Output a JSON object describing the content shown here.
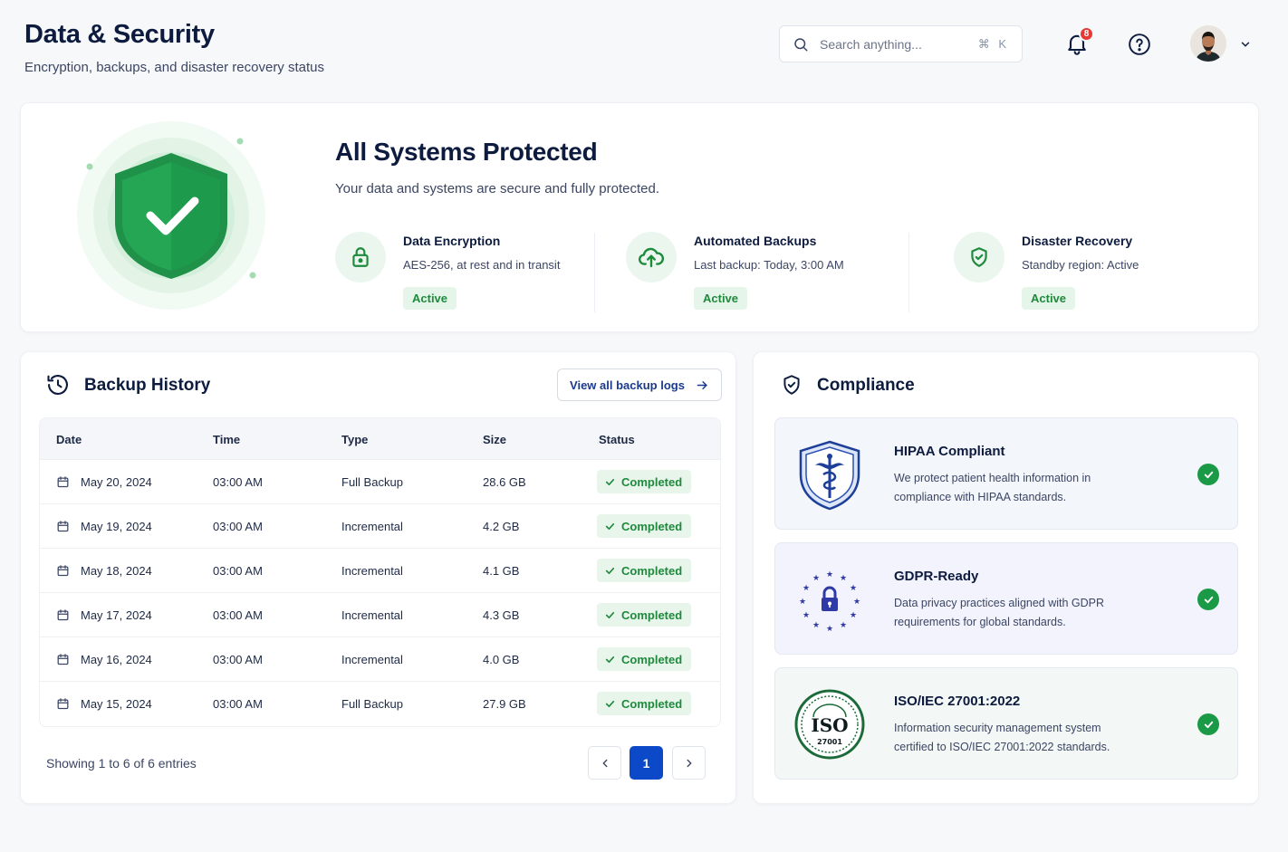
{
  "header": {
    "title": "Data & Security",
    "subtitle": "Encryption, backups, and disaster recovery status",
    "search_placeholder": "Search anything...",
    "search_shortcut": "⌘ K",
    "notification_count": "8"
  },
  "hero": {
    "title": "All Systems Protected",
    "subtitle": "Your data and systems are secure and fully protected.",
    "features": [
      {
        "title": "Data Encryption",
        "desc": "AES-256, at rest and in transit",
        "status": "Active",
        "icon": "lock-icon"
      },
      {
        "title": "Automated Backups",
        "desc": "Last backup: Today, 3:00 AM",
        "status": "Active",
        "icon": "cloud-upload-icon"
      },
      {
        "title": "Disaster Recovery",
        "desc": "Standby region: Active",
        "status": "Active",
        "icon": "shield-check-icon"
      }
    ]
  },
  "backup": {
    "title": "Backup History",
    "view_logs": "View all backup logs",
    "columns": [
      "Date",
      "Time",
      "Type",
      "Size",
      "Status"
    ],
    "rows": [
      {
        "date": "May 20, 2024",
        "time": "03:00 AM",
        "type": "Full Backup",
        "size": "28.6 GB",
        "status": "Completed"
      },
      {
        "date": "May 19, 2024",
        "time": "03:00 AM",
        "type": "Incremental",
        "size": "4.2 GB",
        "status": "Completed"
      },
      {
        "date": "May 18, 2024",
        "time": "03:00 AM",
        "type": "Incremental",
        "size": "4.1 GB",
        "status": "Completed"
      },
      {
        "date": "May 17, 2024",
        "time": "03:00 AM",
        "type": "Incremental",
        "size": "4.3 GB",
        "status": "Completed"
      },
      {
        "date": "May 16, 2024",
        "time": "03:00 AM",
        "type": "Incremental",
        "size": "4.0 GB",
        "status": "Completed"
      },
      {
        "date": "May 15, 2024",
        "time": "03:00 AM",
        "type": "Full Backup",
        "size": "27.9 GB",
        "status": "Completed"
      }
    ],
    "showing": "Showing 1 to 6 of 6 entries",
    "current_page": "1"
  },
  "compliance": {
    "title": "Compliance",
    "items": [
      {
        "title": "HIPAA Compliant",
        "desc": "We protect patient health information in compliance with HIPAA standards.",
        "icon": "hipaa-shield-icon"
      },
      {
        "title": "GDPR-Ready",
        "desc": "Data privacy practices aligned with GDPR requirements for global standards.",
        "icon": "gdpr-stars-lock-icon"
      },
      {
        "title": "ISO/IEC 27001:2022",
        "desc": "Information security management system certified to ISO/IEC 27001:2022 standards.",
        "icon": "iso-seal-icon",
        "seal_text": [
          "ISO",
          "27001"
        ]
      }
    ]
  },
  "colors": {
    "accent_blue": "#0b49c9",
    "success_green": "#1e8a3c",
    "badge_red": "#e53935"
  }
}
